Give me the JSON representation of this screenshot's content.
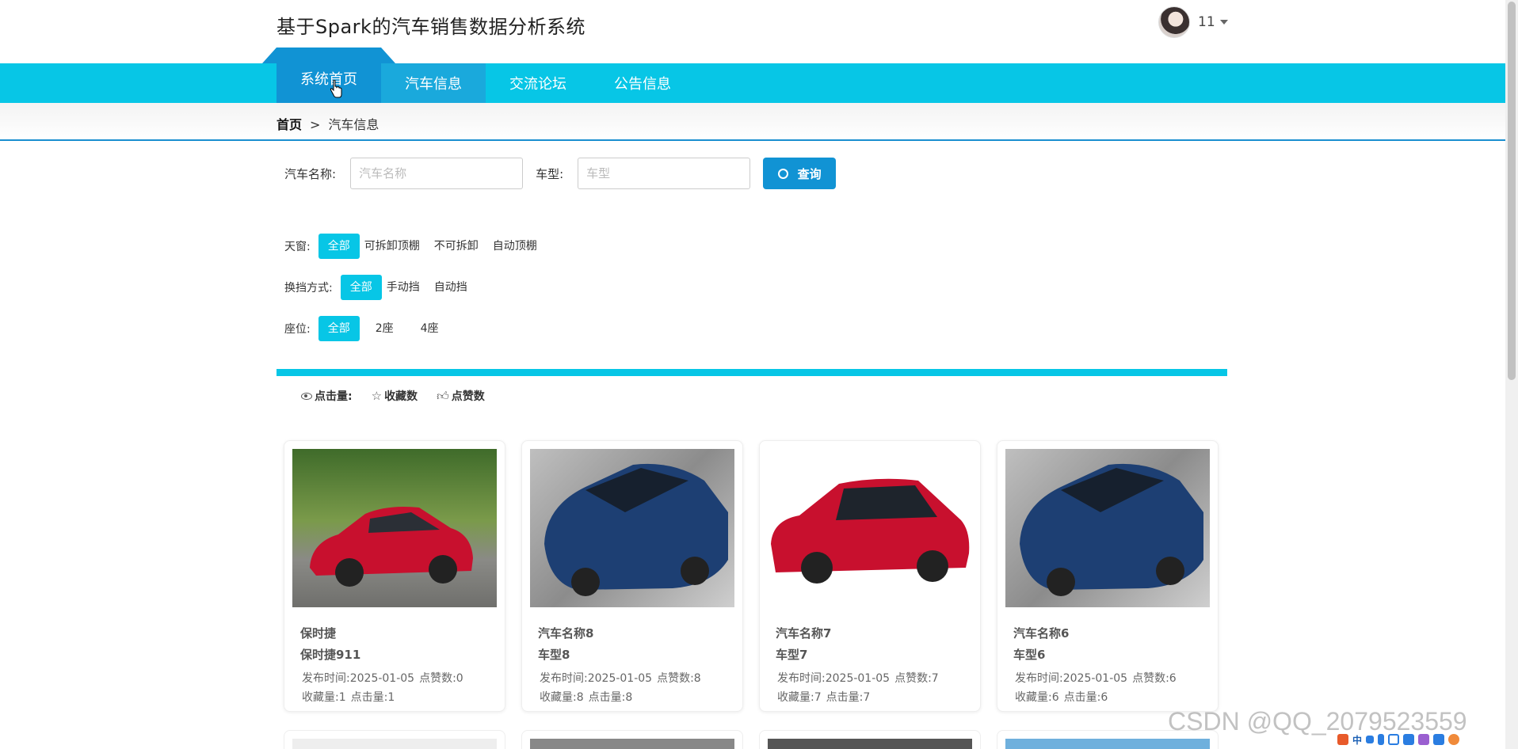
{
  "header": {
    "title": "基于Spark的汽车销售数据分析系统",
    "user_name": "11"
  },
  "nav": {
    "items": [
      {
        "label": "系统首页"
      },
      {
        "label": "汽车信息"
      },
      {
        "label": "交流论坛"
      },
      {
        "label": "公告信息"
      }
    ]
  },
  "breadcrumb": {
    "home": "首页",
    "separator": ">",
    "current": "汽车信息"
  },
  "search": {
    "name_label": "汽车名称:",
    "name_placeholder": "汽车名称",
    "type_label": "车型:",
    "type_placeholder": "车型",
    "button_label": "查询"
  },
  "filters": {
    "sunroof": {
      "label": "天窗:",
      "options": [
        "全部",
        "可拆卸顶棚",
        "不可拆卸",
        "自动顶棚"
      ],
      "selected": "全部"
    },
    "gear": {
      "label": "换挡方式:",
      "options": [
        "全部",
        "手动挡",
        "自动挡"
      ],
      "selected": "全部"
    },
    "seats": {
      "label": "座位:",
      "options": [
        "全部",
        "2座",
        "4座"
      ],
      "selected": "全部"
    }
  },
  "sort": {
    "clicks": "点击量:",
    "favorites": "收藏数",
    "likes": "点赞数"
  },
  "cards": [
    {
      "title": "保时捷",
      "subtitle": "保时捷911",
      "publish": "发布时间:2025-01-05",
      "likes": "点赞数:0",
      "favorites": "收藏量:1",
      "clicks": "点击量:1",
      "car_color": "#c8102e"
    },
    {
      "title": "汽车名称8",
      "subtitle": "车型8",
      "publish": "发布时间:2025-01-05",
      "likes": "点赞数:8",
      "favorites": "收藏量:8",
      "clicks": "点击量:8",
      "car_color": "#1d3f73"
    },
    {
      "title": "汽车名称7",
      "subtitle": "车型7",
      "publish": "发布时间:2025-01-05",
      "likes": "点赞数:7",
      "favorites": "收藏量:7",
      "clicks": "点击量:7",
      "car_color": "#c8102e"
    },
    {
      "title": "汽车名称6",
      "subtitle": "车型6",
      "publish": "发布时间:2025-01-05",
      "likes": "点赞数:6",
      "favorites": "收藏量:6",
      "clicks": "点击量:6",
      "car_color": "#1d3f73"
    }
  ],
  "watermark": "CSDN @QQ_2079523559",
  "tray": {
    "ime": "中"
  },
  "colors": {
    "primary": "#07c6e6",
    "accent": "#1193d4"
  }
}
